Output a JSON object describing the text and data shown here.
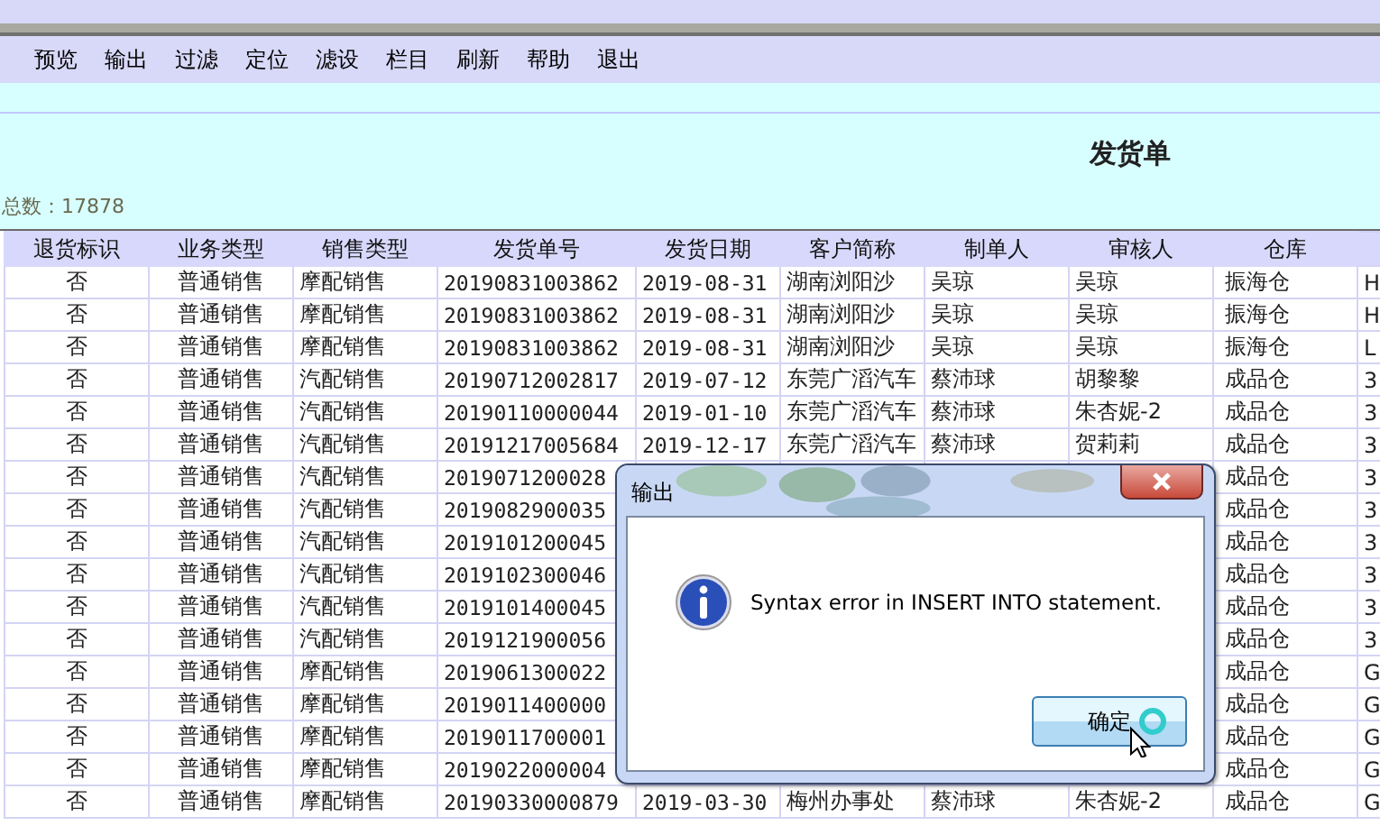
{
  "toolbar": [
    {
      "label": "预览"
    },
    {
      "label": "输出"
    },
    {
      "label": "过滤"
    },
    {
      "label": "定位"
    },
    {
      "label": "滤设"
    },
    {
      "label": "栏目"
    },
    {
      "label": "刷新"
    },
    {
      "label": "帮助"
    },
    {
      "label": "退出"
    }
  ],
  "title": "发货单",
  "total": "总数：17878",
  "table": {
    "columns": [
      "退货标识",
      "业务类型",
      "销售类型",
      "发货单号",
      "发货日期",
      "客户简称",
      "制单人",
      "审核人",
      "仓库"
    ],
    "rows": [
      {
        "cells": [
          "否",
          "普通销售",
          "摩配销售",
          "20190831003862",
          "2019-08-31",
          "湖南浏阳沙",
          "吴琼",
          "吴琼",
          "振海仓",
          "H"
        ]
      },
      {
        "cells": [
          "否",
          "普通销售",
          "摩配销售",
          "20190831003862",
          "2019-08-31",
          "湖南浏阳沙",
          "吴琼",
          "吴琼",
          "振海仓",
          "H"
        ]
      },
      {
        "cells": [
          "否",
          "普通销售",
          "摩配销售",
          "20190831003862",
          "2019-08-31",
          "湖南浏阳沙",
          "吴琼",
          "吴琼",
          "振海仓",
          "L"
        ]
      },
      {
        "cells": [
          "否",
          "普通销售",
          "汽配销售",
          "20190712002817",
          "2019-07-12",
          "东莞广滔汽车",
          "蔡沛球",
          "胡黎黎",
          "成品仓",
          "3"
        ]
      },
      {
        "cells": [
          "否",
          "普通销售",
          "汽配销售",
          "20190110000044",
          "2019-01-10",
          "东莞广滔汽车",
          "蔡沛球",
          "朱杏妮-2",
          "成品仓",
          "3"
        ]
      },
      {
        "cells": [
          "否",
          "普通销售",
          "汽配销售",
          "20191217005684",
          "2019-12-17",
          "东莞广滔汽车",
          "蔡沛球",
          "贺莉莉",
          "成品仓",
          "3"
        ]
      },
      {
        "cells": [
          "否",
          "普通销售",
          "汽配销售",
          "2019071200028",
          null,
          null,
          null,
          null,
          "成品仓",
          "3"
        ]
      },
      {
        "cells": [
          "否",
          "普通销售",
          "汽配销售",
          "2019082900035",
          null,
          null,
          null,
          null,
          "成品仓",
          "3"
        ]
      },
      {
        "cells": [
          "否",
          "普通销售",
          "汽配销售",
          "2019101200045",
          null,
          null,
          null,
          null,
          "成品仓",
          "3"
        ]
      },
      {
        "cells": [
          "否",
          "普通销售",
          "汽配销售",
          "2019102300046",
          null,
          null,
          null,
          null,
          "成品仓",
          "3"
        ]
      },
      {
        "cells": [
          "否",
          "普通销售",
          "汽配销售",
          "2019101400045",
          null,
          null,
          null,
          null,
          "成品仓",
          "3"
        ]
      },
      {
        "cells": [
          "否",
          "普通销售",
          "汽配销售",
          "2019121900056",
          null,
          null,
          null,
          null,
          "成品仓",
          "3"
        ]
      },
      {
        "cells": [
          "否",
          "普通销售",
          "摩配销售",
          "2019061300022",
          null,
          null,
          null,
          null,
          "成品仓",
          "G"
        ]
      },
      {
        "cells": [
          "否",
          "普通销售",
          "摩配销售",
          "2019011400000",
          null,
          null,
          null,
          null,
          "成品仓",
          "G"
        ]
      },
      {
        "cells": [
          "否",
          "普通销售",
          "摩配销售",
          "2019011700001",
          null,
          null,
          null,
          null,
          "成品仓",
          "G"
        ]
      },
      {
        "cells": [
          "否",
          "普通销售",
          "摩配销售",
          "2019022000004",
          null,
          null,
          null,
          null,
          "成品仓",
          "G"
        ]
      },
      {
        "cells": [
          "否",
          "普通销售",
          "摩配销售",
          "20190330000879",
          "2019-03-30",
          "梅州办事处",
          "蔡沛球",
          "朱杏妮-2",
          "成品仓",
          "G"
        ]
      }
    ]
  },
  "dialog": {
    "title": "输出",
    "message": "Syntax error in INSERT INTO statement.",
    "button": "确定"
  }
}
